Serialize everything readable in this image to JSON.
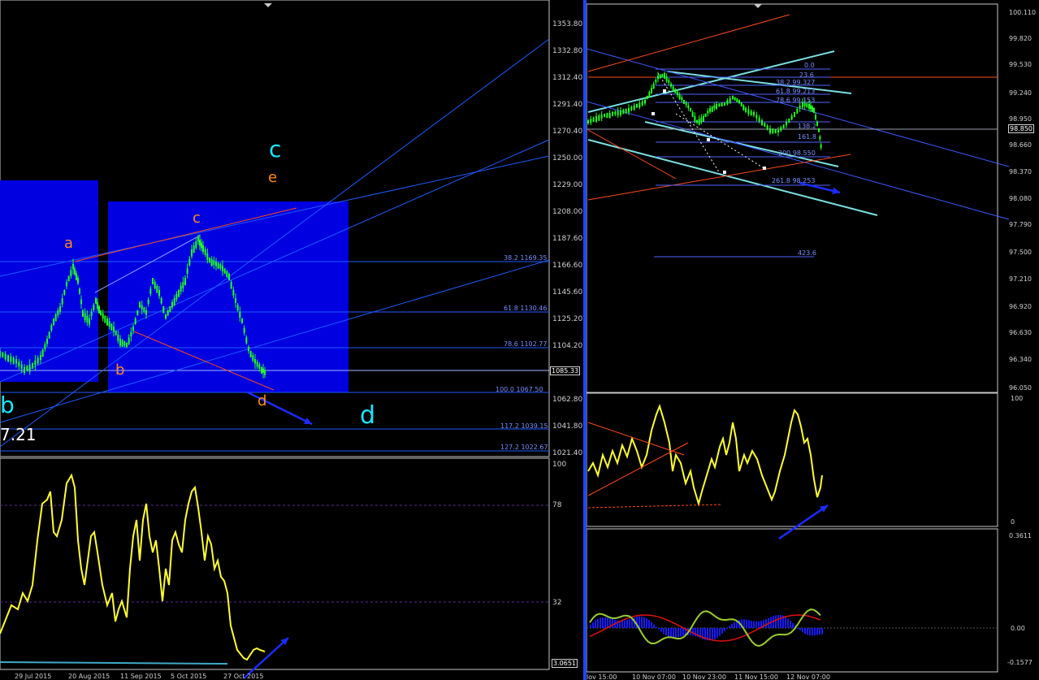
{
  "left_chart": {
    "price_axis": [
      "1353.80",
      "1332.80",
      "1312.40",
      "1291.40",
      "1270.40",
      "1250.00",
      "1229.00",
      "1208.00",
      "1187.60",
      "1166.60",
      "1145.60",
      "1125.20",
      "1104.20",
      "1083.20",
      "1062.80",
      "1041.80",
      "1021.40"
    ],
    "current_price": "1085.33",
    "fib_levels": [
      "38.2 1169.35",
      "61.8 1130.46",
      "78.6 1102.77",
      "100.0 1067.50",
      "117.2 1039.15",
      "127.2 1022.67"
    ],
    "wave_labels": {
      "a": "a",
      "b": "b",
      "c": "c",
      "d": "d",
      "e": "e",
      "big_c": "c",
      "big_d": "d",
      "big_b": "b"
    },
    "price_fragment": "7.21",
    "colors": {
      "zone": "#0000e0",
      "wave_orange": "#ff8c1a",
      "wave_cyan": "#19e6ff",
      "price_line": "#1f5bff",
      "candle": "#22ff22",
      "trend_red": "#ff4a1a"
    }
  },
  "left_oscillator": {
    "levels": [
      "100",
      "78",
      "32"
    ],
    "current_value": "3.0651"
  },
  "left_time_axis": [
    "29 Jul 2015",
    "20 Aug 2015",
    "11 Sep 2015",
    "5 Oct 2015",
    "27 Oct 2015"
  ],
  "right_chart": {
    "price_axis": [
      "100.110",
      "99.820",
      "99.530",
      "99.240",
      "98.950",
      "98.660",
      "98.370",
      "98.080",
      "97.790",
      "97.500",
      "97.210",
      "96.920",
      "96.630",
      "96.340",
      "96.050"
    ],
    "current_price": "98.850",
    "fib_labels": [
      "0.0",
      "23.6",
      "38.2 99.327",
      "61.8 99.213",
      "78.6 99.153",
      "138.2",
      "161.8",
      "200 98.550",
      "261.8 98.253",
      "423.6"
    ],
    "colors": {
      "oscillator": "#ffff33",
      "histogram": "#1a1aff",
      "signal": "#e01010",
      "macd": "#9acd32"
    }
  },
  "right_oscillator": {
    "levels": [
      "100",
      "0"
    ]
  },
  "right_macd": {
    "levels": [
      "0.3611",
      "0.00",
      "-0.1577"
    ]
  },
  "right_time_axis": [
    "lov 15:00",
    "10 Nov 07:00",
    "10 Nov 23:00",
    "11 Nov 15:00",
    "12 Nov 07:00"
  ]
}
